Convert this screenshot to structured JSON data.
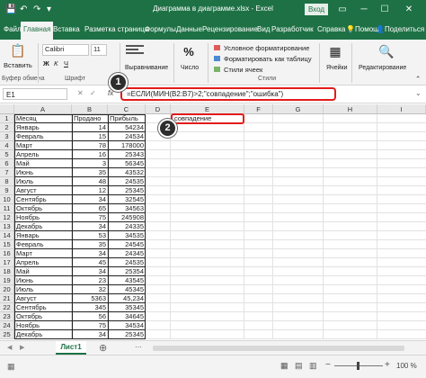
{
  "titlebar": {
    "title": "Диаграмма в диаграмме.xlsx - Excel",
    "login": "Вход",
    "save_icon": "💾",
    "undo_icon": "↶",
    "redo_icon": "↷",
    "more_icon": "▾",
    "display_icon": "▭",
    "minimize_icon": "─",
    "maximize_icon": "☐",
    "close_icon": "✕"
  },
  "tabs": [
    "Файл",
    "Главная",
    "Вставка",
    "Разметка страницы",
    "Формулы",
    "Данные",
    "Рецензирование",
    "Вид",
    "Разработчик",
    "Справка",
    "Помощ",
    "Поделиться"
  ],
  "tabs_icons": {
    "help": "💡",
    "share": "👤"
  },
  "ribbon": {
    "paste_label": "Вставить",
    "font_name": "Calibri",
    "font_size": "11",
    "bold": "Ж",
    "italic": "К",
    "underline": "Ч",
    "alignment_label": "Выравнивание",
    "number_label": "Число",
    "cond_format": "Условное форматирование",
    "format_table": "Форматировать как таблицу",
    "cell_styles": "Стили ячеек",
    "cells_label": "Ячейки",
    "editing_label": "Редактирование",
    "groups": [
      "Буфер обмена",
      "Шрифт",
      "Стили"
    ],
    "paste_icon": "📋",
    "cells_icon": "▦",
    "editing_icon": "🔍",
    "percent_icon": "%",
    "expand_icon": "⌃"
  },
  "formula_bar": {
    "name_box": "E1",
    "fx": "fx",
    "formula": "=ЕСЛИ(МИН(B2:B7)>2;\"совпадение\";\"ошибка\")",
    "cancel_icon": "✕",
    "enter_icon": "✓",
    "expand_icon": "⌄"
  },
  "badges": [
    "1",
    "2"
  ],
  "columns": [
    "A",
    "B",
    "C",
    "D",
    "E",
    "F",
    "G",
    "H",
    "I"
  ],
  "rows": [
    {
      "n": "1",
      "a": "Месяц",
      "b": "Продано",
      "c": "Прибыль",
      "e": "совпадение"
    },
    {
      "n": "2",
      "a": "Январь",
      "b": "14",
      "c": "54234",
      "e": ""
    },
    {
      "n": "3",
      "a": "Февраль",
      "b": "15",
      "c": "24534",
      "e": ""
    },
    {
      "n": "4",
      "a": "Март",
      "b": "78",
      "c": "178000",
      "e": ""
    },
    {
      "n": "5",
      "a": "Апрель",
      "b": "16",
      "c": "25343",
      "e": ""
    },
    {
      "n": "6",
      "a": "Май",
      "b": "3",
      "c": "56345",
      "e": ""
    },
    {
      "n": "7",
      "a": "Июнь",
      "b": "35",
      "c": "43532",
      "e": ""
    },
    {
      "n": "8",
      "a": "Июль",
      "b": "48",
      "c": "24535",
      "e": ""
    },
    {
      "n": "9",
      "a": "Август",
      "b": "12",
      "c": "25345",
      "e": ""
    },
    {
      "n": "10",
      "a": "Сентябрь",
      "b": "34",
      "c": "32545",
      "e": ""
    },
    {
      "n": "11",
      "a": "Октябрь",
      "b": "65",
      "c": "34563",
      "e": ""
    },
    {
      "n": "12",
      "a": "Ноябрь",
      "b": "75",
      "c": "245908",
      "e": ""
    },
    {
      "n": "13",
      "a": "Декабрь",
      "b": "34",
      "c": "24335",
      "e": ""
    },
    {
      "n": "14",
      "a": "Январь",
      "b": "53",
      "c": "34535",
      "e": ""
    },
    {
      "n": "15",
      "a": "Февраль",
      "b": "35",
      "c": "24545",
      "e": ""
    },
    {
      "n": "16",
      "a": "Март",
      "b": "34",
      "c": "24345",
      "e": ""
    },
    {
      "n": "17",
      "a": "Апрель",
      "b": "45",
      "c": "24535",
      "e": ""
    },
    {
      "n": "18",
      "a": "Май",
      "b": "34",
      "c": "25354",
      "e": ""
    },
    {
      "n": "19",
      "a": "Июнь",
      "b": "23",
      "c": "43545",
      "e": ""
    },
    {
      "n": "20",
      "a": "Июль",
      "b": "32",
      "c": "45345",
      "e": ""
    },
    {
      "n": "21",
      "a": "Август",
      "b": "5363",
      "c": "45,234",
      "e": ""
    },
    {
      "n": "22",
      "a": "Сентябрь",
      "b": "345",
      "c": "35345",
      "e": ""
    },
    {
      "n": "23",
      "a": "Октябрь",
      "b": "56",
      "c": "34645",
      "e": ""
    },
    {
      "n": "24",
      "a": "Ноябрь",
      "b": "75",
      "c": "34534",
      "e": ""
    },
    {
      "n": "25",
      "a": "Декабрь",
      "b": "34",
      "c": "25345",
      "e": ""
    }
  ],
  "sheet": {
    "tab_name": "Лист1",
    "add_icon": "⊕",
    "prev_icon": "◀",
    "next_icon": "▶",
    "more_icon": "⋯"
  },
  "status": {
    "ready_icon": "▦",
    "zoom": "100 %",
    "zoom_minus": "−",
    "zoom_plus": "+",
    "view_normal_icon": "▦",
    "view_layout_icon": "▤",
    "view_break_icon": "▥"
  }
}
